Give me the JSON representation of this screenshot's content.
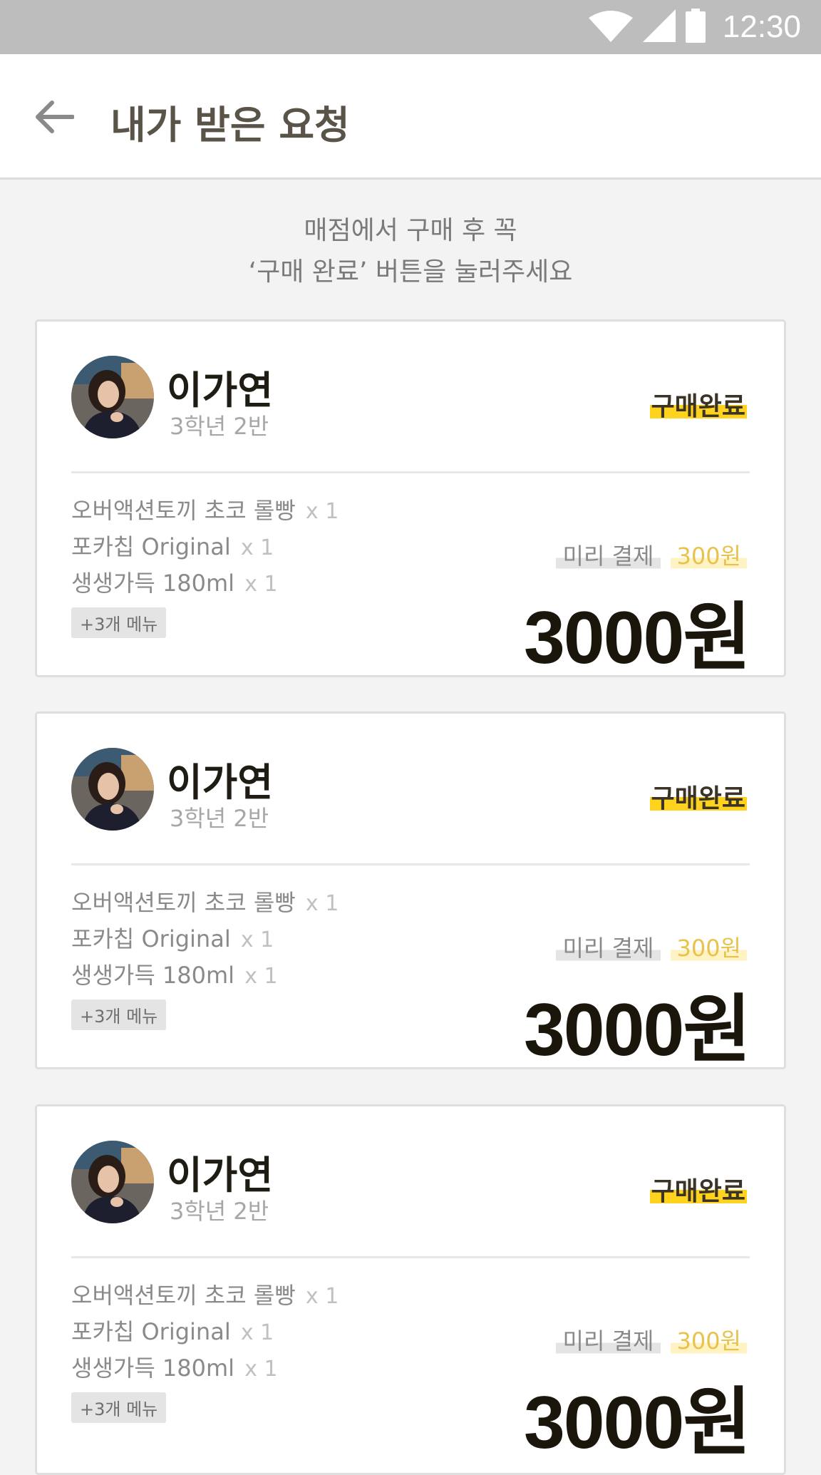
{
  "status_bar": {
    "time": "12:30",
    "icons": [
      "wifi-icon",
      "signal-icon",
      "battery-icon"
    ]
  },
  "header": {
    "title": "내가 받은 요청",
    "back_icon": "arrow-left-icon"
  },
  "notice": {
    "line1": "매점에서 구매 후 꼭",
    "line2": "‘구매 완료’ 버튼을 눌러주세요"
  },
  "colors": {
    "accent": "#ffd21e",
    "prepay_amount": "#e8c24a",
    "background": "#f3f3f3"
  },
  "requests": [
    {
      "name": "이가연",
      "class_info": "3학년 2반",
      "status": "구매완료",
      "items": [
        {
          "name": "오버액션토끼 초코 롤빵",
          "qty": "x 1"
        },
        {
          "name": "포카칩 Original",
          "qty": "x 1"
        },
        {
          "name": "생생가득 180ml",
          "qty": "x 1"
        }
      ],
      "more_menu": "+3개 메뉴",
      "prepay_label": "미리 결제",
      "prepay_amount": "300원",
      "total": "3000원"
    },
    {
      "name": "이가연",
      "class_info": "3학년 2반",
      "status": "구매완료",
      "items": [
        {
          "name": "오버액션토끼 초코 롤빵",
          "qty": "x 1"
        },
        {
          "name": "포카칩 Original",
          "qty": "x 1"
        },
        {
          "name": "생생가득 180ml",
          "qty": "x 1"
        }
      ],
      "more_menu": "+3개 메뉴",
      "prepay_label": "미리 결제",
      "prepay_amount": "300원",
      "total": "3000원"
    },
    {
      "name": "이가연",
      "class_info": "3학년 2반",
      "status": "구매완료",
      "items": [
        {
          "name": "오버액션토끼 초코 롤빵",
          "qty": "x 1"
        },
        {
          "name": "포카칩 Original",
          "qty": "x 1"
        },
        {
          "name": "생생가득 180ml",
          "qty": "x 1"
        }
      ],
      "more_menu": "+3개 메뉴",
      "prepay_label": "미리 결제",
      "prepay_amount": "300원",
      "total": "3000원"
    }
  ]
}
